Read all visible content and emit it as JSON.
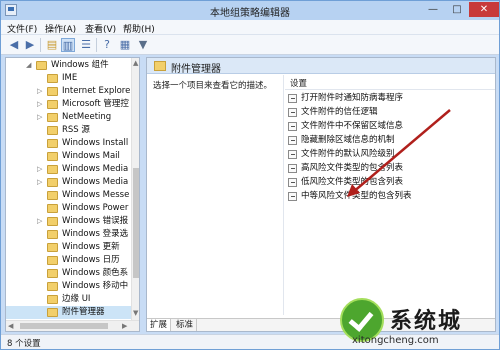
{
  "window": {
    "title": "本地组策略编辑器",
    "controls": {
      "minimize": "—",
      "maximize": "□",
      "close": "✕"
    }
  },
  "menu": [
    "文件(F)",
    "操作(A)",
    "查看(V)",
    "帮助(H)"
  ],
  "toolbar": {
    "icons": [
      "back-arrow-icon",
      "forward-arrow-icon",
      "folder-up-icon",
      "show-hide-tree-icon",
      "list-icon",
      "help-icon",
      "properties-icon",
      "filter-icon"
    ]
  },
  "tree": {
    "items": [
      {
        "label": "Windows 组件",
        "expand": "◢",
        "indent": 0
      },
      {
        "label": "IME",
        "expand": "",
        "indent": 1
      },
      {
        "label": "Internet Explore",
        "expand": "▷",
        "indent": 1
      },
      {
        "label": "Microsoft 管理控",
        "expand": "▷",
        "indent": 1
      },
      {
        "label": "NetMeeting",
        "expand": "▷",
        "indent": 1
      },
      {
        "label": "RSS 源",
        "expand": "",
        "indent": 1
      },
      {
        "label": "Windows Install",
        "expand": "",
        "indent": 1
      },
      {
        "label": "Windows Mail",
        "expand": "",
        "indent": 1
      },
      {
        "label": "Windows Media",
        "expand": "▷",
        "indent": 1
      },
      {
        "label": "Windows Media",
        "expand": "▷",
        "indent": 1
      },
      {
        "label": "Windows Messe",
        "expand": "",
        "indent": 1
      },
      {
        "label": "Windows Power",
        "expand": "",
        "indent": 1
      },
      {
        "label": "Windows 错误报",
        "expand": "▷",
        "indent": 1
      },
      {
        "label": "Windows 登录选",
        "expand": "",
        "indent": 1
      },
      {
        "label": "Windows 更新",
        "expand": "",
        "indent": 1
      },
      {
        "label": "Windows 日历",
        "expand": "",
        "indent": 1
      },
      {
        "label": "Windows 颜色系",
        "expand": "",
        "indent": 1
      },
      {
        "label": "Windows 移动中",
        "expand": "",
        "indent": 1
      },
      {
        "label": "边缘 UI",
        "expand": "",
        "indent": 1
      },
      {
        "label": "附件管理器",
        "expand": "",
        "indent": 1
      }
    ],
    "scroll_arrows": {
      "up": "▲",
      "down": "▼",
      "left": "◀",
      "right": "▶"
    }
  },
  "details": {
    "header_title": "附件管理器",
    "description": "选择一个项目来查看它的描述。",
    "column_header": "设置",
    "settings": [
      "打开附件时通知防病毒程序",
      "文件附件的信任逻辑",
      "文件附件中不保留区域信息",
      "隐藏删除区域信息的机制",
      "文件附件的默认风险级别",
      "高风险文件类型的包含列表",
      "低风险文件类型的包含列表",
      "中等风险文件类型的包含列表"
    ],
    "tabs": [
      "扩展",
      "标准"
    ]
  },
  "status": {
    "text": "8 个设置"
  },
  "watermark": {
    "text": "系统城",
    "url": "xitongcheng.com"
  },
  "colors": {
    "titlebar": "#b7d2f2",
    "selection": "#cce4f7",
    "annotation_arrow": "#b0201c",
    "watermark_green": "#4da62e"
  }
}
